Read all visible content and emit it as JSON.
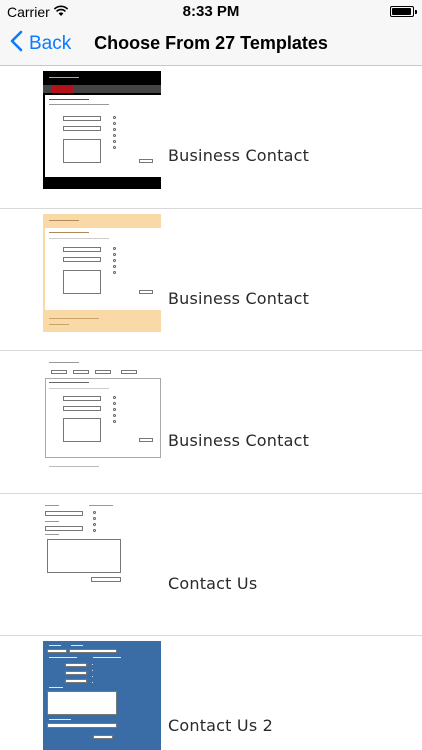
{
  "status": {
    "carrier": "Carrier",
    "time": "8:33 PM",
    "battery_level": 0.95
  },
  "nav": {
    "back_label": "Back",
    "title": "Choose From 27 Templates"
  },
  "templates": [
    {
      "label": "Business Contact",
      "thumb_style": "black-red"
    },
    {
      "label": "Business Contact",
      "thumb_style": "peach"
    },
    {
      "label": "Business Contact",
      "thumb_style": "white"
    },
    {
      "label": "Contact Us",
      "thumb_style": "plain"
    },
    {
      "label": "Contact Us 2",
      "thumb_style": "blue"
    }
  ]
}
